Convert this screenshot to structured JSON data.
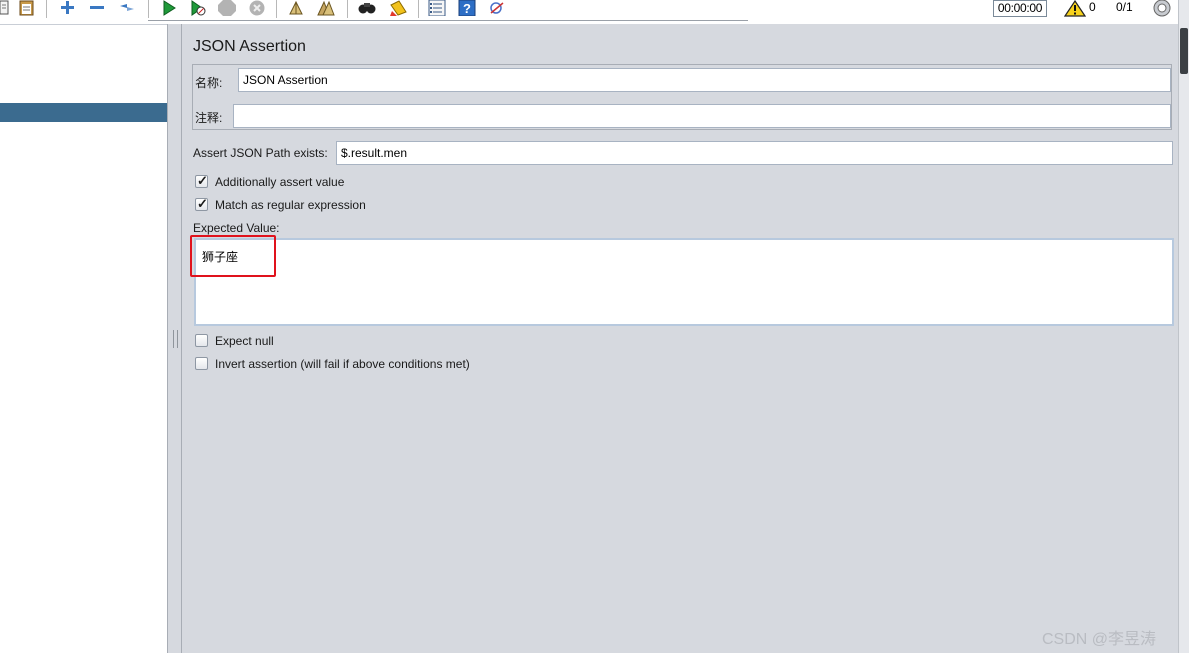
{
  "toolbar": {
    "timer": "00:00:00",
    "warning_count": "0",
    "thread_count": "0/1",
    "icons": [
      "template-icon",
      "clipboard-icon",
      "expand-icon",
      "collapse-icon",
      "toggle-icon",
      "start-icon",
      "start-no-pause-icon",
      "stop-icon",
      "shutdown-icon",
      "clear-icon",
      "clear-all-icon",
      "search-icon",
      "reset-search-icon",
      "function-helper-icon",
      "help-icon",
      "remote-icon",
      "warning-icon",
      "thread-indicator-icon"
    ]
  },
  "panel": {
    "title": "JSON Assertion",
    "name_label": "名称:",
    "name_value": "JSON Assertion",
    "comment_label": "注释:",
    "comment_value": "",
    "path_label": "Assert JSON Path exists:",
    "path_value": "$.result.men",
    "additionally_assert_label": "Additionally assert value",
    "additionally_assert_checked": true,
    "regex_label": "Match as regular expression",
    "regex_checked": true,
    "expected_label": "Expected Value:",
    "expected_value": "狮子座",
    "expect_null_label": "Expect null",
    "expect_null_checked": false,
    "invert_label": "Invert assertion (will fail if above conditions met)",
    "invert_checked": false
  },
  "watermark": "CSDN @李昱涛",
  "colors": {
    "panel_bg": "#d6d9df",
    "tree_selection": "#3b6b8f",
    "highlight_border": "#e0121c"
  }
}
